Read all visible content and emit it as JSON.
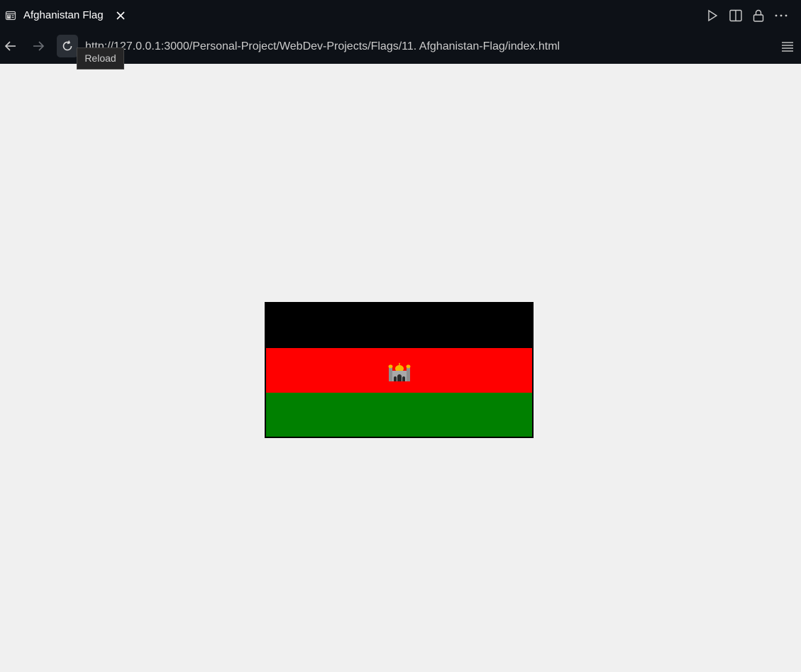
{
  "tab": {
    "title": "Afghanistan Flag",
    "icon": "browser-preview-icon",
    "close_icon": "close-icon"
  },
  "toolbar_actions": [
    "play-icon",
    "split-editor-icon",
    "lock-icon",
    "more-actions-icon"
  ],
  "nav": {
    "back_icon": "arrow-left-icon",
    "forward_icon": "arrow-right-icon",
    "reload_icon": "reload-icon",
    "url": "http://127.0.0.1:3000/Personal-Project/WebDev-Projects/Flags/11. Afghanistan-Flag/index.html",
    "menu_icon": "hamburger-menu-icon"
  },
  "tooltip": {
    "text": "Reload"
  },
  "flag": {
    "colors": {
      "top": "#000000",
      "middle": "#ff0000",
      "bottom": "#008000"
    },
    "emblem": "mosque-emoji"
  },
  "colors": {
    "chrome_bg": "#0d1117",
    "page_bg": "#f0f0f0"
  }
}
